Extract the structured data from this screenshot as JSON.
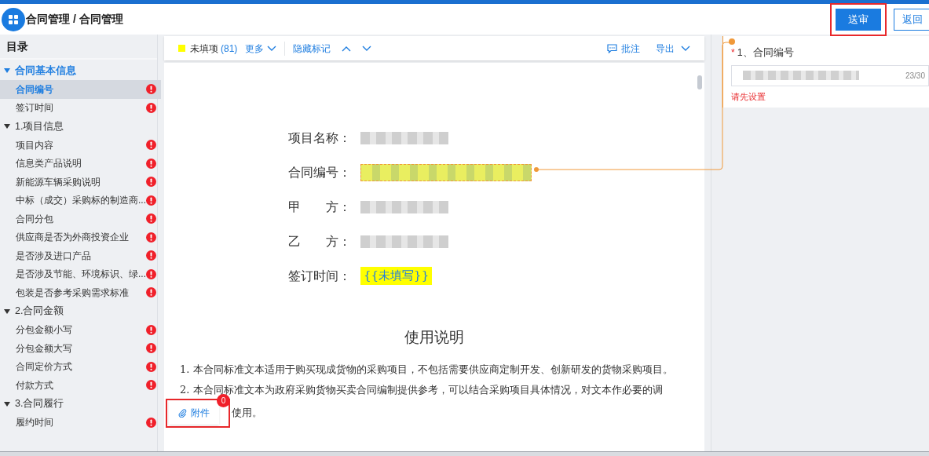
{
  "header": {
    "breadcrumb": "合同管理 / 合同管理",
    "actions": [
      {
        "label": "送审",
        "kind": "primary",
        "highlighted": true
      },
      {
        "label": "返回",
        "kind": "outline",
        "highlighted": false
      }
    ]
  },
  "sidebar": {
    "title": "目录",
    "sections": [
      {
        "label": "合同基本信息",
        "expanded": true,
        "active": true,
        "children": [
          {
            "label": "合同编号",
            "selected": true,
            "warning": true
          },
          {
            "label": "签订时间",
            "selected": false,
            "warning": true
          }
        ]
      },
      {
        "label": "1.项目信息",
        "expanded": true,
        "active": false,
        "children": [
          {
            "label": "项目内容",
            "selected": false,
            "warning": true
          },
          {
            "label": "信息类产品说明",
            "selected": false,
            "warning": true
          },
          {
            "label": "新能源车辆采购说明",
            "selected": false,
            "warning": true
          },
          {
            "label": "中标（成交）采购标的制造商...",
            "selected": false,
            "warning": true
          },
          {
            "label": "合同分包",
            "selected": false,
            "warning": true
          },
          {
            "label": "供应商是否为外商投资企业",
            "selected": false,
            "warning": true
          },
          {
            "label": "是否涉及进口产品",
            "selected": false,
            "warning": true
          },
          {
            "label": "是否涉及节能、环境标识、绿...",
            "selected": false,
            "warning": true
          },
          {
            "label": "包装是否参考采购需求标准",
            "selected": false,
            "warning": true
          }
        ]
      },
      {
        "label": "2.合同金额",
        "expanded": true,
        "active": false,
        "children": [
          {
            "label": "分包金额小写",
            "selected": false,
            "warning": true
          },
          {
            "label": "分包金额大写",
            "selected": false,
            "warning": true
          },
          {
            "label": "合同定价方式",
            "selected": false,
            "warning": true
          },
          {
            "label": "付款方式",
            "selected": false,
            "warning": true
          }
        ]
      },
      {
        "label": "3.合同履行",
        "expanded": true,
        "active": false,
        "children": [
          {
            "label": "履约时间",
            "selected": false,
            "warning": true
          }
        ]
      }
    ]
  },
  "toolbar": {
    "unfilled_label": "未填项",
    "unfilled_count": "(81)",
    "more": "更多",
    "hide_marks": "隐藏标记",
    "comment": "批注",
    "export": "导出"
  },
  "document": {
    "fields": [
      {
        "label": "项目名称：",
        "kind": "redacted",
        "highlighted": false
      },
      {
        "label": "合同编号：",
        "kind": "redacted",
        "highlighted": true
      },
      {
        "label": "甲　　方：",
        "kind": "redacted",
        "highlighted": false
      },
      {
        "label": "乙　　方：",
        "kind": "redacted",
        "highlighted": false
      },
      {
        "label": "签订时间：",
        "kind": "text",
        "value": "{{未填写}}",
        "highlighted": true
      }
    ],
    "heading": "使用说明",
    "paragraphs": [
      "1. 本合同标准文本适用于购买现成货物的采购项目，不包括需要供应商定制开发、创新研发的货物采购项目。",
      "2. 本合同标准文本为政府采购货物买卖合同编制提供参考，可以结合采购项目具体情况，对文本作必要的调"
    ],
    "trailing_fragment": "使用。"
  },
  "attachment": {
    "label": "附件",
    "count": "0",
    "highlighted": true
  },
  "detail_panel": {
    "required_mark": "*",
    "field_label": "1、合同编号",
    "counter": "23/30",
    "error": "请先设置"
  }
}
